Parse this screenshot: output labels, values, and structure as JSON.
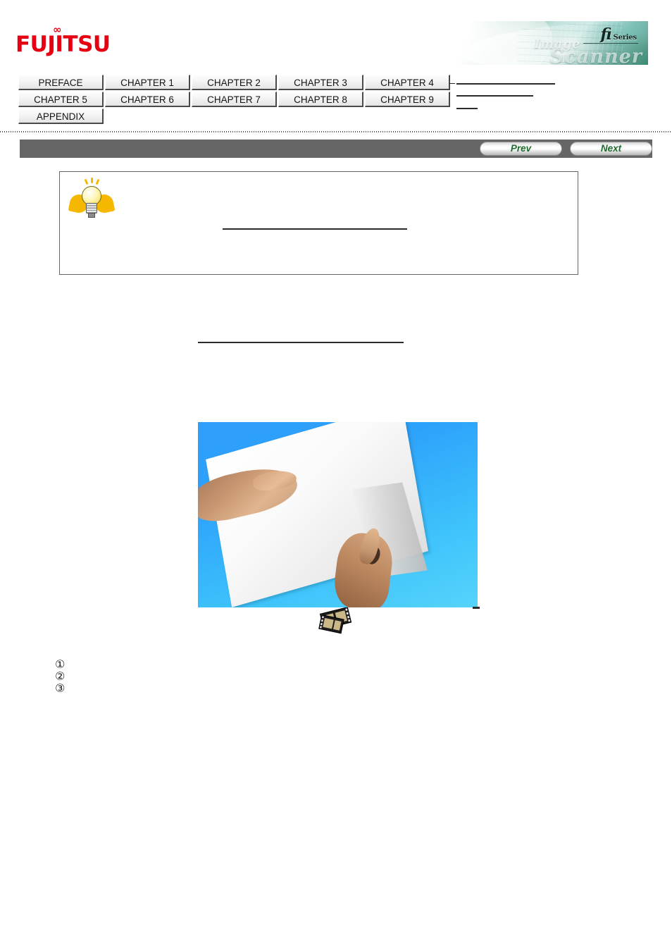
{
  "page": {
    "title": "fi Series Image Scanner Operator's Guide",
    "background_color": "#ffffff"
  },
  "header": {
    "logo": {
      "text": "FUJITSU",
      "infinity_mark": "∞",
      "color": "#e60012"
    },
    "banner": {
      "product_mark": "fi",
      "series_label": "Series",
      "image_word": "Image",
      "scanner_word": "Scanner",
      "accent_color": "#3c8a72"
    }
  },
  "navigation": {
    "rows": [
      [
        {
          "label": "PREFACE",
          "name": "tab-preface"
        },
        {
          "label": "CHAPTER 1",
          "name": "tab-chapter-1"
        },
        {
          "label": "CHAPTER 2",
          "name": "tab-chapter-2"
        },
        {
          "label": "CHAPTER 3",
          "name": "tab-chapter-3"
        },
        {
          "label": "CHAPTER 4",
          "name": "tab-chapter-4"
        }
      ],
      [
        {
          "label": "CHAPTER 5",
          "name": "tab-chapter-5"
        },
        {
          "label": "CHAPTER 6",
          "name": "tab-chapter-6"
        },
        {
          "label": "CHAPTER 7",
          "name": "tab-chapter-7"
        },
        {
          "label": "CHAPTER 8",
          "name": "tab-chapter-8"
        },
        {
          "label": "CHAPTER 9",
          "name": "tab-chapter-9"
        }
      ],
      [
        {
          "label": "APPENDIX",
          "name": "tab-appendix"
        }
      ]
    ]
  },
  "toolbar": {
    "prev_label": "Prev",
    "next_label": "Next",
    "background_color": "#666666",
    "button_text_color": "#1f6b2e"
  },
  "hint": {
    "icon": "lightbulb-icon",
    "body_text": "",
    "link_text": ""
  },
  "content": {
    "link_text": "",
    "photo": {
      "alt": "Hands fanning a stack of white paper on a blue background",
      "background_color": "#2f9dfa"
    },
    "video_icon": "film-strip-icon",
    "steps": [
      {
        "marker": "①",
        "text": ""
      },
      {
        "marker": "②",
        "text": ""
      },
      {
        "marker": "③",
        "text": ""
      }
    ]
  }
}
